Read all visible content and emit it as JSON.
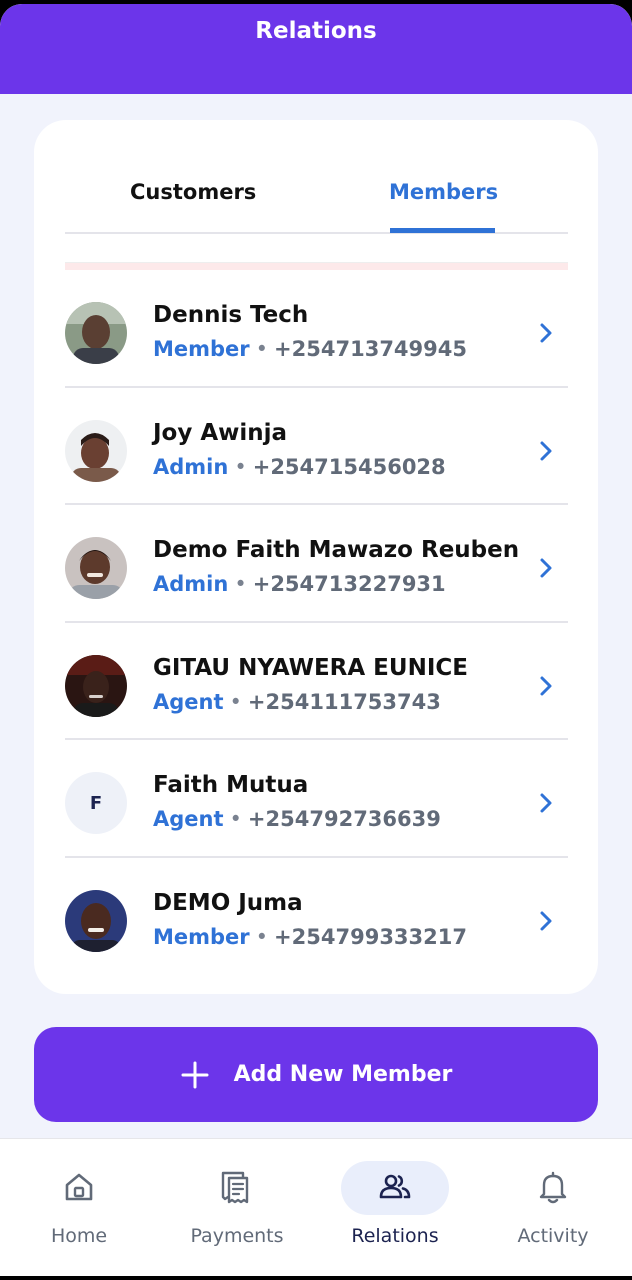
{
  "header": {
    "title": "Relations"
  },
  "tabs": [
    {
      "label": "Customers",
      "active": false
    },
    {
      "label": "Members",
      "active": true
    }
  ],
  "members": [
    {
      "name": "Dennis Tech",
      "role": "Member",
      "phone": "+254713749945",
      "avatar": "photo"
    },
    {
      "name": "Joy Awinja",
      "role": "Admin",
      "phone": "+254715456028",
      "avatar": "photo"
    },
    {
      "name": "Demo Faith Mawazo Reuben",
      "role": "Admin",
      "phone": "+254713227931",
      "avatar": "photo"
    },
    {
      "name": "GITAU NYAWERA EUNICE",
      "role": "Agent",
      "phone": "+254111753743",
      "avatar": "photo"
    },
    {
      "name": "Faith Mutua",
      "role": "Agent",
      "phone": "+254792736639",
      "avatar": "F"
    },
    {
      "name": "DEMO Juma",
      "role": "Member",
      "phone": "+254799333217",
      "avatar": "photo"
    }
  ],
  "separator": "•",
  "add_button": {
    "label": "Add New Member",
    "icon": "plus-icon"
  },
  "bottom_nav": [
    {
      "label": "Home",
      "icon": "home-icon",
      "active": false
    },
    {
      "label": "Payments",
      "icon": "receipt-icon",
      "active": false
    },
    {
      "label": "Relations",
      "icon": "people-icon",
      "active": true
    },
    {
      "label": "Activity",
      "icon": "bell-icon",
      "active": false
    }
  ],
  "colors": {
    "header": "#6c35ea",
    "accent_blue": "#2f72d6",
    "background": "#f1f3fc",
    "nav_active_pill": "#e9eefb"
  }
}
